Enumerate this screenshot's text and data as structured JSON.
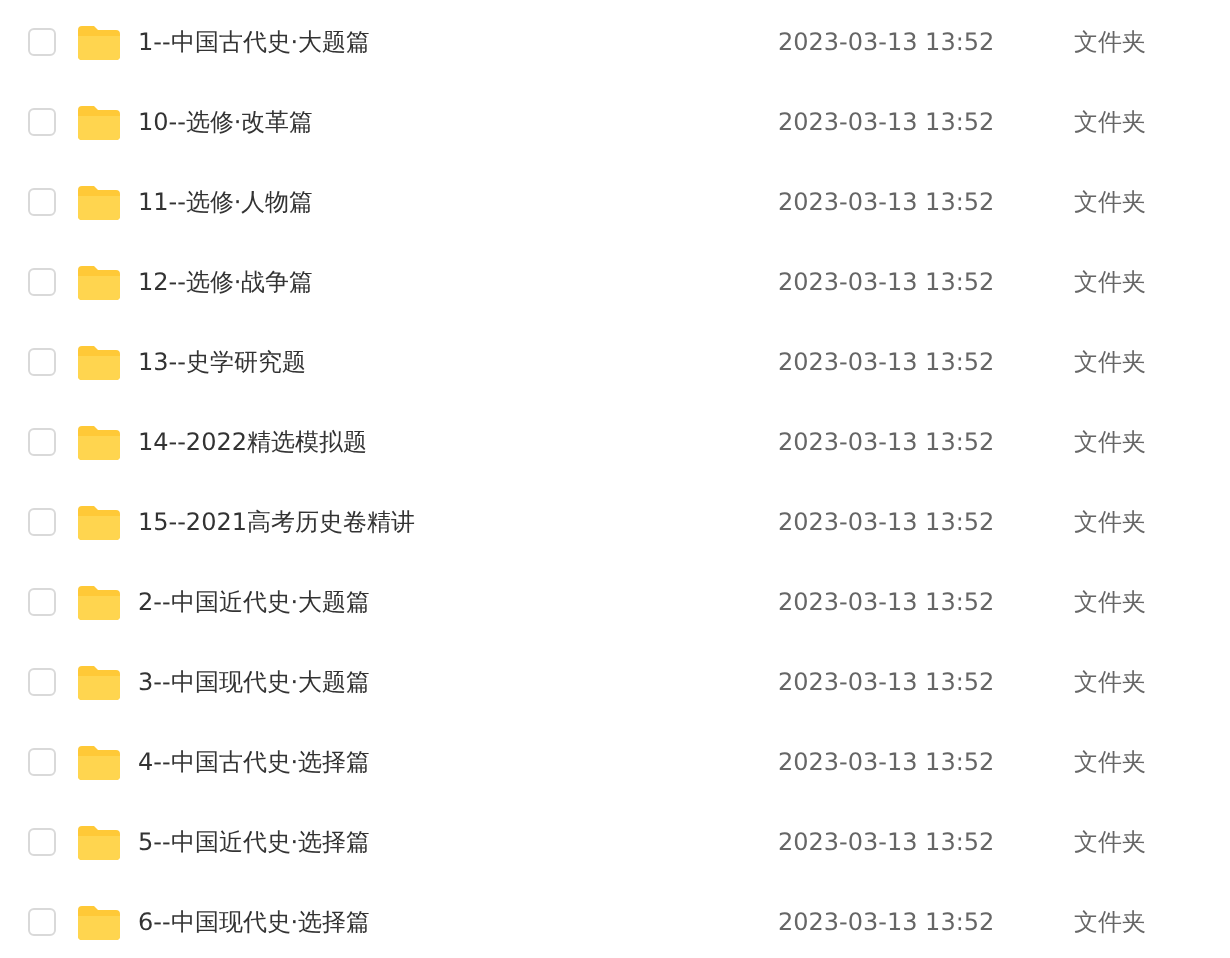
{
  "files": [
    {
      "name": "1--中国古代史·大题篇",
      "modified": "2023-03-13 13:52",
      "type": "文件夹",
      "checked": false
    },
    {
      "name": "10--选修·改革篇",
      "modified": "2023-03-13 13:52",
      "type": "文件夹",
      "checked": false
    },
    {
      "name": "11--选修·人物篇",
      "modified": "2023-03-13 13:52",
      "type": "文件夹",
      "checked": false
    },
    {
      "name": "12--选修·战争篇",
      "modified": "2023-03-13 13:52",
      "type": "文件夹",
      "checked": false
    },
    {
      "name": "13--史学研究题",
      "modified": "2023-03-13 13:52",
      "type": "文件夹",
      "checked": false
    },
    {
      "name": "14--2022精选模拟题",
      "modified": "2023-03-13 13:52",
      "type": "文件夹",
      "checked": false
    },
    {
      "name": "15--2021高考历史卷精讲",
      "modified": "2023-03-13 13:52",
      "type": "文件夹",
      "checked": false
    },
    {
      "name": "2--中国近代史·大题篇",
      "modified": "2023-03-13 13:52",
      "type": "文件夹",
      "checked": false
    },
    {
      "name": "3--中国现代史·大题篇",
      "modified": "2023-03-13 13:52",
      "type": "文件夹",
      "checked": false
    },
    {
      "name": "4--中国古代史·选择篇",
      "modified": "2023-03-13 13:52",
      "type": "文件夹",
      "checked": false
    },
    {
      "name": "5--中国近代史·选择篇",
      "modified": "2023-03-13 13:52",
      "type": "文件夹",
      "checked": false
    },
    {
      "name": "6--中国现代史·选择篇",
      "modified": "2023-03-13 13:52",
      "type": "文件夹",
      "checked": false
    }
  ]
}
